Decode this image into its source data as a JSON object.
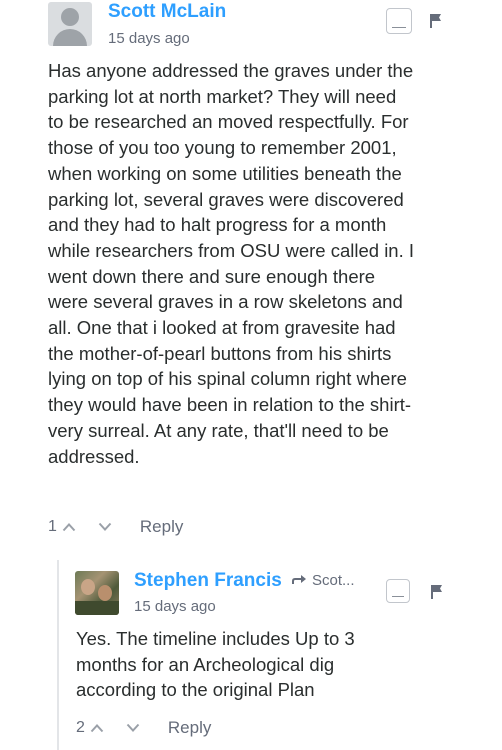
{
  "comments": [
    {
      "author": "Scott McLain",
      "time": "15 days ago",
      "lines": [
        "Has anyone addressed the graves under the",
        "parking lot at north market? They will need",
        "to be researched an moved respectfully. For",
        "those of you too young to remember 2001,",
        "when working on some utilities beneath the",
        "parking lot, several graves were discovered",
        "and they had to halt progress for a month",
        "while researchers from OSU were called in. I",
        "went down there and sure enough there",
        "were several graves in a row skeletons and",
        "all. One that i looked at from gravesite had",
        "the mother-of-pearl buttons from his shirts",
        "lying on top of his spinal column right where",
        "they would have been in relation to the shirt-",
        "very surreal. At any rate, that'll need to be",
        "addressed."
      ],
      "upvotes": "1",
      "reply_label": "Reply"
    },
    {
      "author": "Stephen Francis",
      "reply_to": "Scot...",
      "time": "15 days ago",
      "lines": [
        "Yes. The timeline includes Up to 3",
        "months for an Archeological dig",
        "according to the original Plan"
      ],
      "upvotes": "2",
      "reply_label": "Reply"
    }
  ],
  "colors": {
    "author": "#2e9fff",
    "meta": "#656c7a",
    "text": "#2a2e2e"
  },
  "icons": [
    "avatar-placeholder-icon",
    "collapse-icon",
    "flag-icon",
    "upvote-icon",
    "downvote-icon",
    "reply-arrow-icon"
  ]
}
